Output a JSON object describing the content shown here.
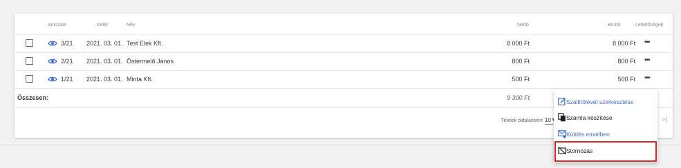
{
  "colors": {
    "accent": "#3f6fc9",
    "highlight": "#e02424",
    "text": "#3a3a3a"
  },
  "table": {
    "headers": {
      "number": "Sorszám",
      "date": "Kelte",
      "name": "Név",
      "net": "Nettó",
      "gross": "Bruttó",
      "options": "Lehetőségek"
    },
    "rows": [
      {
        "number": "3/21",
        "date": "2021. 03. 01.",
        "name": "Test Elek Kft.",
        "net": "8 000 Ft",
        "gross": "8 000 Ft",
        "more": "•••"
      },
      {
        "number": "2/21",
        "date": "2021. 03. 01.",
        "name": "Östermelő János",
        "net": "800 Ft",
        "gross": "800 Ft",
        "more": "•••"
      },
      {
        "number": "1/21",
        "date": "2021. 03. 01.",
        "name": "Minta Kft.",
        "net": "500 Ft",
        "gross": "500 Ft",
        "more": "•••"
      }
    ],
    "total_label": "Összesen:",
    "total_net": "9 300 Ft"
  },
  "pagination": {
    "per_page_label": "Tételek oldalanként",
    "per_page_value": "10",
    "last_page_glyph": ">|"
  },
  "menu": {
    "items": [
      {
        "label": "Szállítólevél szerkesztése",
        "icon": "edit-icon"
      },
      {
        "label": "Számla készítése",
        "icon": "copy-document-icon"
      },
      {
        "label": "Küldés emailben",
        "icon": "mail-send-icon"
      },
      {
        "label": "Stornózás",
        "icon": "cancel-document-icon"
      }
    ]
  }
}
